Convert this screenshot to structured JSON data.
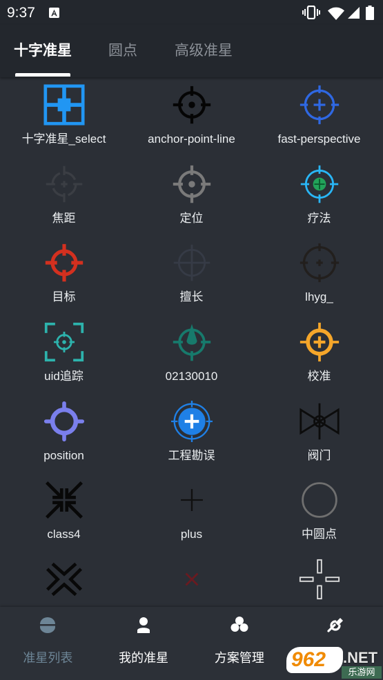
{
  "status_bar": {
    "time": "9:37",
    "icons": [
      "app-a-icon",
      "vibrate-icon",
      "wifi-icon",
      "signal-icon",
      "battery-icon"
    ]
  },
  "theme": {
    "tab_active_color": "#ffffff",
    "tab_inactive_color": "#8c9198",
    "nav_active_color": "#6d8596",
    "nav_inactive_color": "#ffffff"
  },
  "tabs": [
    {
      "label": "十字准星",
      "active": true
    },
    {
      "label": "圆点",
      "active": false
    },
    {
      "label": "高级准星",
      "active": false
    }
  ],
  "grid": {
    "items": [
      {
        "label": "十字准星_select",
        "icon": "grid-crosshair-icon",
        "color": "#2196f3"
      },
      {
        "label": "anchor-point-line",
        "icon": "crosshair-dot-icon",
        "color": "#050505"
      },
      {
        "label": "fast-perspective",
        "icon": "crosshair-plus-icon",
        "color": "#2f68e3"
      },
      {
        "label": "焦距",
        "icon": "crosshair-faint-icon",
        "color": "#3b3e44"
      },
      {
        "label": "定位",
        "icon": "crosshair-dot-icon",
        "color": "#7a7a7a"
      },
      {
        "label": "疗法",
        "icon": "crosshair-target-icon",
        "color": "#29b6f6",
        "accent_color": "#22a35a"
      },
      {
        "label": "目标",
        "icon": "crosshair-bold-icon",
        "color": "#d3301f"
      },
      {
        "label": "擅长",
        "icon": "crosshair-lines-icon",
        "color": "#363b46"
      },
      {
        "label": "lhyg_",
        "icon": "crosshair-plus-icon",
        "color": "#221f1d"
      },
      {
        "label": "uid追踪",
        "icon": "bracket-crosshair-icon",
        "color": "#2db3ad"
      },
      {
        "label": "02130010",
        "icon": "arrow-crosshair-icon",
        "color": "#177a6c"
      },
      {
        "label": "校准",
        "icon": "ring-plus-icon",
        "color": "#f5a62a"
      },
      {
        "label": "position",
        "icon": "thick-ring-icon",
        "color": "#7a7fec"
      },
      {
        "label": "工程勘误",
        "icon": "filled-plus-circle-icon",
        "color": "#1f80e6",
        "accent_color": "#ffffff"
      },
      {
        "label": "阀门",
        "icon": "valve-icon",
        "color": "#0c0c0c"
      },
      {
        "label": "class4",
        "icon": "inward-arrows-icon",
        "color": "#080808"
      },
      {
        "label": "plus",
        "icon": "plus-icon",
        "color": "#101010"
      },
      {
        "label": "中圆点",
        "icon": "circle-outline-icon",
        "color": "#6f6f6f"
      },
      {
        "icon": "inward-chevrons-icon",
        "color": "#080808"
      },
      {
        "icon": "x-icon",
        "color": "#6a1a20"
      },
      {
        "icon": "gap-crosshair-icon",
        "color": "#dddddd"
      }
    ]
  },
  "bottom_nav": {
    "items": [
      {
        "label": "准星列表",
        "icon": "helmet-icon",
        "active": true
      },
      {
        "label": "我的准星",
        "icon": "person-icon",
        "active": false
      },
      {
        "label": "方案管理",
        "icon": "club-icon",
        "active": false
      },
      {
        "icon": "tools-icon",
        "active": false
      }
    ]
  },
  "watermark": {
    "brand": "962",
    "suffix": ".NET",
    "name": "乐游网"
  }
}
